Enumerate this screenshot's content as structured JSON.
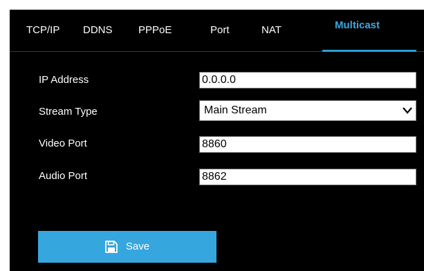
{
  "tabs": [
    {
      "label": "TCP/IP",
      "active": false
    },
    {
      "label": "DDNS",
      "active": false
    },
    {
      "label": "PPPoE",
      "active": false
    },
    {
      "label": "Port",
      "active": false
    },
    {
      "label": "NAT",
      "active": false
    },
    {
      "label": "Multicast",
      "active": true
    }
  ],
  "form": {
    "ip_address": {
      "label": "IP Address",
      "value": "0.0.0.0"
    },
    "stream_type": {
      "label": "Stream Type",
      "value": "Main Stream"
    },
    "video_port": {
      "label": "Video Port",
      "value": "8860"
    },
    "audio_port": {
      "label": "Audio Port",
      "value": "8862"
    }
  },
  "save": {
    "label": "Save",
    "icon": "floppy-disk-icon"
  },
  "colors": {
    "accent": "#35a6de",
    "active_tab_text": "#3aa8e0",
    "background": "#000000",
    "text": "#ffffff"
  }
}
